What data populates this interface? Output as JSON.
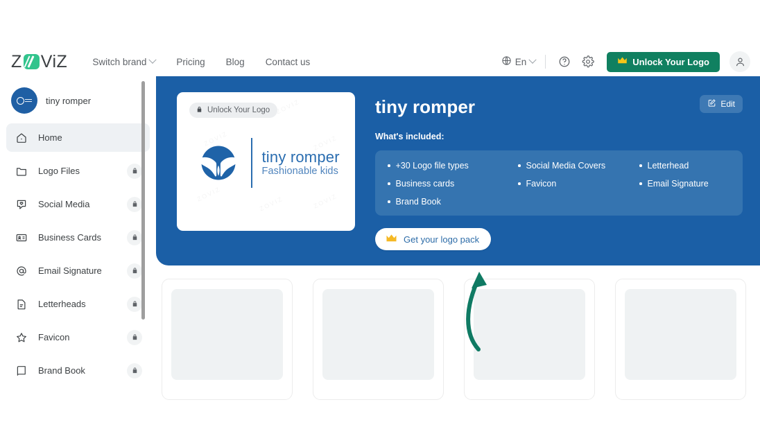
{
  "brand": {
    "logo_text_left": "Z",
    "logo_text_right": "ViZ",
    "accent_green": "#32c48d"
  },
  "header": {
    "nav": [
      {
        "label": "Switch brand",
        "icon": "chevron-down-icon",
        "has_chevron": true
      },
      {
        "label": "Pricing",
        "has_chevron": false
      },
      {
        "label": "Blog",
        "has_chevron": false
      },
      {
        "label": "Contact us",
        "has_chevron": false
      }
    ],
    "language": {
      "label": "En",
      "icon": "globe-icon"
    },
    "help_icon": "help-circle-icon",
    "settings_icon": "gear-icon",
    "unlock_button": {
      "label": "Unlock Your Logo",
      "icon": "crown-icon",
      "color": "#108060"
    },
    "account_icon": "user-avatar-icon"
  },
  "sidebar": {
    "brand_name": "tiny romper",
    "items": [
      {
        "label": "Home",
        "icon": "home-icon",
        "locked": false,
        "active": true
      },
      {
        "label": "Logo Files",
        "icon": "folder-icon",
        "locked": true,
        "active": false
      },
      {
        "label": "Social Media",
        "icon": "shield-heart-icon",
        "locked": true,
        "active": false
      },
      {
        "label": "Business Cards",
        "icon": "id-card-icon",
        "locked": true,
        "active": false
      },
      {
        "label": "Email Signature",
        "icon": "at-sign-icon",
        "locked": true,
        "active": false
      },
      {
        "label": "Letterheads",
        "icon": "document-icon",
        "locked": true,
        "active": false
      },
      {
        "label": "Favicon",
        "icon": "star-icon",
        "locked": true,
        "active": false
      },
      {
        "label": "Brand Book",
        "icon": "book-icon",
        "locked": true,
        "active": false
      }
    ],
    "lock_icon": "lock-icon"
  },
  "hero": {
    "background_color": "#1b5fa6",
    "title": "tiny romper",
    "edit_button": {
      "label": "Edit",
      "icon": "edit-pencil-icon"
    },
    "included_label": "What's included:",
    "features": [
      "+30 Logo file types",
      "Social Media Covers",
      "Letterhead",
      "Business cards",
      "Favicon",
      "Email Signature",
      "Brand Book"
    ],
    "cta_button": {
      "label": "Get your logo pack",
      "icon": "crown-icon"
    },
    "logo_card": {
      "unlock_pill": {
        "label": "Unlock Your Logo",
        "icon": "lock-icon"
      },
      "logo_name": "tiny romper",
      "logo_tagline": "Fashionable kids",
      "watermark": "ZOVIZ"
    }
  },
  "content": {
    "skeleton_card_count": 4
  },
  "annotation": {
    "arrow_color": "#0f7a63",
    "arrow_points_to": "Get your logo pack"
  }
}
